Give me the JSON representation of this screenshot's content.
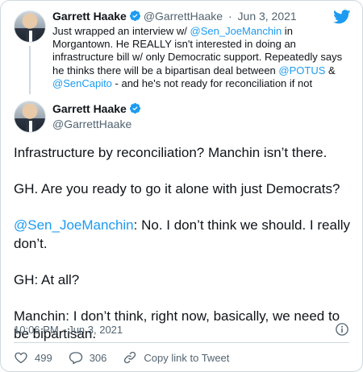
{
  "quoted_tweet": {
    "author_name": "Garrett Haake",
    "handle": "@GarrettHaake",
    "date": "Jun 3, 2021",
    "separator": "·",
    "text_1": "Just wrapped an interview w/ ",
    "mention_1": "@Sen_JoeManchin",
    "text_2": " in Morgantown. He REALLY isn't interested in doing an infrastructure bill w/ only Democratic support. Repeatedly says he thinks there will be a bipartisan deal between ",
    "mention_2": "@POTUS",
    "text_3": " & ",
    "mention_3": "@SenCapito",
    "text_4": " - and he's not ready for reconciliation if not"
  },
  "main_tweet": {
    "author_name": "Garrett Haake",
    "handle": "@GarrettHaake",
    "para_1": "Infrastructure by reconciliation? Manchin isn’t there.",
    "para_2": "GH. Are you ready to go it alone with just Democrats?",
    "para_3_mention": "@Sen_JoeManchin",
    "para_3_text": ": No. I don’t think we should. I really don’t.",
    "para_4": "GH: At all?",
    "para_5": "Manchin: I don’t think, right now, basically, we need to be bipartisan.",
    "timestamp": "10:06 PM · Jun 3, 2021"
  },
  "actions": {
    "likes": "499",
    "replies": "306",
    "copy_link_label": "Copy link to Tweet"
  },
  "icons": {
    "brand": "twitter-bird-icon",
    "verified": "verified-badge-icon",
    "info": "info-icon",
    "like": "heart-icon",
    "reply": "reply-bubble-icon",
    "link": "link-icon"
  },
  "colors": {
    "accent": "#1d9bf0",
    "text": "#0f1419",
    "muted": "#536471",
    "border": "#cfd9de"
  }
}
